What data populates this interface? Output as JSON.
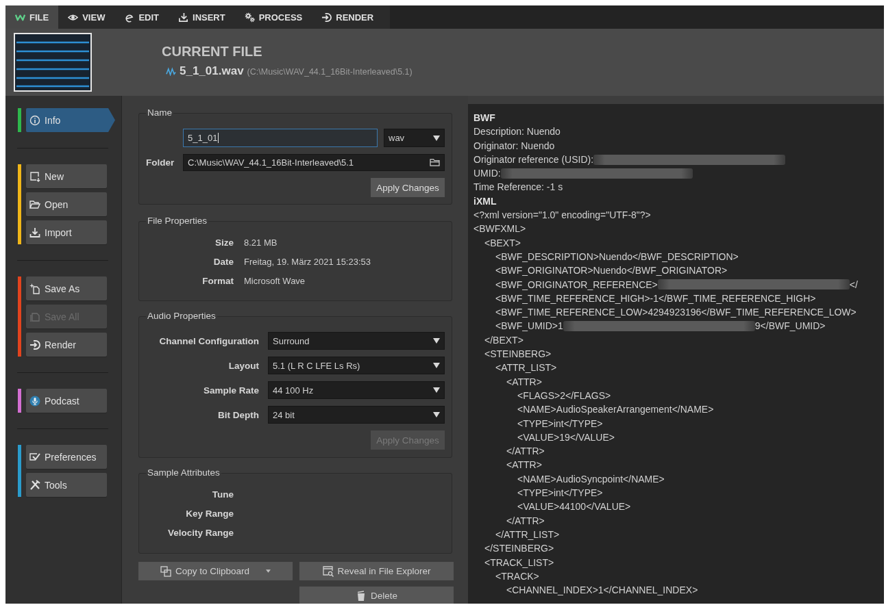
{
  "tabs": [
    {
      "label": "FILE",
      "selected": true
    },
    {
      "label": "VIEW",
      "selected": false
    },
    {
      "label": "EDIT",
      "selected": false
    },
    {
      "label": "INSERT",
      "selected": false
    },
    {
      "label": "PROCESS",
      "selected": false
    },
    {
      "label": "RENDER",
      "selected": false
    }
  ],
  "header": {
    "title": "CURRENT FILE",
    "file_name": "5_1_01.wav",
    "file_path": "(C:\\Music\\WAV_44.1_16Bit-Interleaved\\5.1)"
  },
  "sidebar": {
    "groups": [
      {
        "color": "#2eb84c",
        "items": [
          {
            "label": "Info",
            "selected": true,
            "disabled": false
          }
        ]
      },
      {
        "color": "#f0b619",
        "items": [
          {
            "label": "New",
            "selected": false,
            "disabled": false
          },
          {
            "label": "Open",
            "selected": false,
            "disabled": false
          },
          {
            "label": "Import",
            "selected": false,
            "disabled": false
          }
        ]
      },
      {
        "color": "#e2431e",
        "items": [
          {
            "label": "Save As",
            "selected": false,
            "disabled": false
          },
          {
            "label": "Save All",
            "selected": false,
            "disabled": true
          },
          {
            "label": "Render",
            "selected": false,
            "disabled": false
          }
        ]
      },
      {
        "color": "#d46fd2",
        "items": [
          {
            "label": "Podcast",
            "selected": false,
            "disabled": false
          }
        ]
      },
      {
        "color": "#2a9ccc",
        "items": [
          {
            "label": "Preferences",
            "selected": false,
            "disabled": false
          },
          {
            "label": "Tools",
            "selected": false,
            "disabled": false
          }
        ]
      }
    ]
  },
  "name_group": {
    "title": "Name",
    "file_name": {
      "value": "5_1_01",
      "focused": true
    },
    "extension": "wav",
    "folder_label": "Folder",
    "folder": "C:\\Music\\WAV_44.1_16Bit-Interleaved\\5.1",
    "apply": {
      "label": "Apply Changes",
      "disabled": false
    }
  },
  "file_properties": {
    "title": "File Properties",
    "rows": [
      {
        "label": "Size",
        "value": "8.21 MB"
      },
      {
        "label": "Date",
        "value": "Freitag, 19. März 2021 15:23:53"
      },
      {
        "label": "Format",
        "value": "Microsoft Wave"
      }
    ]
  },
  "audio_properties": {
    "title": "Audio Properties",
    "fields": [
      {
        "label": "Channel Configuration",
        "value": "Surround"
      },
      {
        "label": "Layout",
        "value": "5.1 (L R C LFE Ls Rs)"
      },
      {
        "label": "Sample Rate",
        "value": "44 100 Hz"
      },
      {
        "label": "Bit Depth",
        "value": "24 bit"
      }
    ],
    "apply": {
      "label": "Apply Changes",
      "disabled": true
    }
  },
  "sample_attributes": {
    "title": "Sample Attributes",
    "rows": [
      {
        "label": "Tune"
      },
      {
        "label": "Key Range"
      },
      {
        "label": "Velocity Range"
      }
    ]
  },
  "buttons": [
    {
      "label": "Copy to Clipboard"
    },
    {
      "label": "Reveal in File Explorer"
    },
    {
      "label": "Delete"
    }
  ],
  "metadata": {
    "bwf_heading": "BWF",
    "bwf_lines": [
      {
        "text": "Description: Nuendo",
        "redacted": false
      },
      {
        "text": "Originator: Nuendo",
        "redacted": false
      },
      {
        "text": "Originator reference (USID):",
        "redacted": true
      },
      {
        "text": "UMID:",
        "redacted": true
      },
      {
        "text": "Time Reference: -1 s",
        "redacted": false
      }
    ],
    "ixml_heading": "iXML",
    "ixml_lines": [
      {
        "text": "<?xml version=\"1.0\" encoding=\"UTF-8\"?>",
        "redacted": false
      },
      {
        "text": "<BWFXML>",
        "redacted": false,
        "children": [
          {
            "text": "<BEXT>",
            "redacted": false,
            "children": [
              {
                "text": "<BWF_DESCRIPTION>Nuendo</BWF_DESCRIPTION>",
                "redacted": false
              },
              {
                "text": "<BWF_ORIGINATOR>Nuendo</BWF_ORIGINATOR>",
                "redacted": false
              },
              {
                "text": "<BWF_ORIGINATOR_REFERENCE>",
                "redacted": true,
                "tail": "</"
              },
              {
                "text": "<BWF_TIME_REFERENCE_HIGH>-1</BWF_TIME_REFERENCE_HIGH>",
                "redacted": false
              },
              {
                "text": "<BWF_TIME_REFERENCE_LOW>4294923196</BWF_TIME_REFERENCE_LOW>",
                "redacted": false
              },
              {
                "text": "<BWF_UMID>1",
                "redacted": true,
                "tail": "9</BWF_UMID>"
              }
            ]
          },
          {
            "text": "</BEXT>",
            "redacted": false
          },
          {
            "text": "<STEINBERG>",
            "redacted": false,
            "children": [
              {
                "text": "<ATTR_LIST>",
                "redacted": false,
                "children": [
                  {
                    "text": "<ATTR>",
                    "redacted": false,
                    "children": [
                      {
                        "text": "<FLAGS>2</FLAGS>",
                        "redacted": false
                      },
                      {
                        "text": "<NAME>AudioSpeakerArrangement</NAME>",
                        "redacted": false
                      },
                      {
                        "text": "<TYPE>int</TYPE>",
                        "redacted": false
                      },
                      {
                        "text": "<VALUE>19</VALUE>",
                        "redacted": false
                      }
                    ]
                  },
                  {
                    "text": "</ATTR>",
                    "redacted": false
                  },
                  {
                    "text": "<ATTR>",
                    "redacted": false,
                    "children": [
                      {
                        "text": "<NAME>AudioSyncpoint</NAME>",
                        "redacted": false
                      },
                      {
                        "text": "<TYPE>int</TYPE>",
                        "redacted": false
                      },
                      {
                        "text": "<VALUE>44100</VALUE>",
                        "redacted": false
                      }
                    ]
                  },
                  {
                    "text": "</ATTR>",
                    "redacted": false
                  }
                ]
              },
              {
                "text": "</ATTR_LIST>",
                "redacted": false
              }
            ]
          },
          {
            "text": "</STEINBERG>",
            "redacted": false
          },
          {
            "text": "<TRACK_LIST>",
            "redacted": false,
            "children": [
              {
                "text": "<TRACK>",
                "redacted": false,
                "children": [
                  {
                    "text": "<CHANNEL_INDEX>1</CHANNEL_INDEX>",
                    "redacted": false
                  }
                ]
              }
            ]
          }
        ]
      }
    ]
  }
}
